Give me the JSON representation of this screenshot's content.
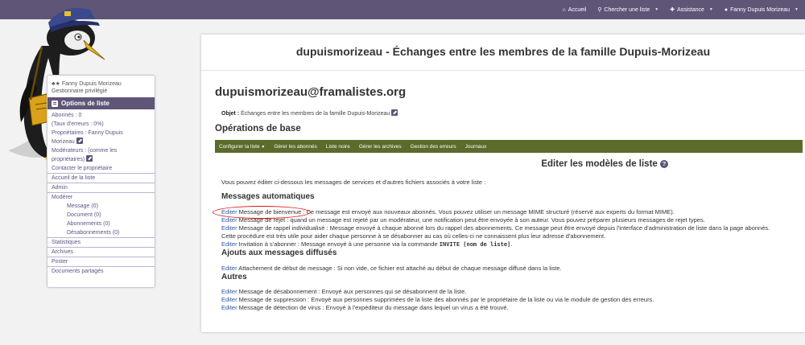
{
  "topnav": {
    "home": "Accueil",
    "search": "Chercher une liste",
    "help": "Assistance",
    "user": "Fanny Dupuis Morizeau"
  },
  "sidebar": {
    "user_name": "Fanny Dupuis Morizeau",
    "user_role": "Gestionnaire privilégié",
    "header": "Options de liste",
    "subscribers": "Abonnés : 0",
    "errors": "(Taux d'erreurs : 0%)",
    "owners_1": "Propriétaires : Fanny Dupuis",
    "owners_2": "Morizeau",
    "moderators_1": "Modérateurs : (comme les",
    "moderators_2": "propriétaires)",
    "contact": "Contacter le propriétaire",
    "list_home": "Accueil de la liste",
    "admin": "Admin",
    "moderate": "Modérer",
    "mod_message": "Message (0)",
    "mod_document": "Document (0)",
    "mod_subscriptions": "Abonnements (0)",
    "mod_unsubscriptions": "Désabonnements (0)",
    "stats": "Statistiques",
    "archives": "Archives",
    "post": "Poster",
    "shared": "Documents partagés"
  },
  "main": {
    "title": "dupuismorizeau - Échanges entre les membres de la famille Dupuis-Morizeau",
    "email": "dupuismorizeau@framalistes.org",
    "objet_label": "Objet :",
    "objet_value": "Échanges entre les membres de la famille Dupuis-Morizeau",
    "ops_title": "Opérations de base",
    "menu": {
      "configure": "Configurer la liste",
      "subscribers": "Gérer les abonnés",
      "blacklist": "Liste noire",
      "archives": "Gérer les archives",
      "bounces": "Gestion des erreurs",
      "logs": "Journaux"
    },
    "section_title": "Editer les modèles de liste",
    "intro": "Vous pouvez éditer ci-dessous les messages de services et d'autres fichiers associés à votre liste :",
    "h_auto": "Messages automatiques",
    "h_diffused": "Ajouts aux messages diffusés",
    "h_other": "Autres",
    "edit_label": "Editer",
    "items": {
      "welcome": " Message de bienvenue : Ce message est envoyé aux nouveaux abonnés. Vous pouvez utiliser un message MIME structuré (réservé aux experts du format MIME).",
      "reject": " Message de rejet : quand un message est rejeté par un modérateur, une notification peut être envoyée à son auteur. Vous pouvez préparer plusieurs messages de rejet types.",
      "remind": " Message de rappel individualisé : Message envoyé à chaque abonné lors du rappel des abonnements. Ce message peut être envoyé depuis l'interface d'administration de liste dans la page abonnés. Cette procédure est très utile pour aider chaque personne à se désabonner au cas où celles-ci ne connaissent plus leur adresse d'abonnement.",
      "invite_pre": " Invitation à s'abonner : Message envoyé à une personne via la commande ",
      "invite_cmd": "INVITE [nom de liste]",
      "invite_post": ".",
      "attach": " Attachement de début de message : Si non vide, ce fichier est attaché au début de chaque message diffusé dans la liste.",
      "bye": " Message de désabonnement : Envoyé aux personnes qui se désabonnent de la liste.",
      "removed": " Message de suppression : Envoyé aux personnes supprimées de la liste des abonnés par le propriétaire de la liste ou via le module de gestion des erreurs.",
      "virus": " Message de détection de virus : Envoyé à l'expéditeur du message dans lequel un virus a été trouvé."
    }
  }
}
